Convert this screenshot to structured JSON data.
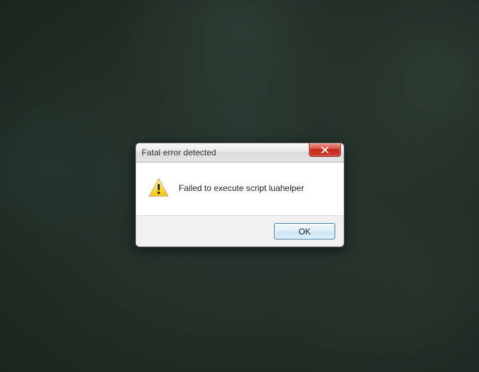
{
  "dialog": {
    "title": "Fatal error detected",
    "message": "Failed to execute script luahelper",
    "ok_label": "OK"
  }
}
